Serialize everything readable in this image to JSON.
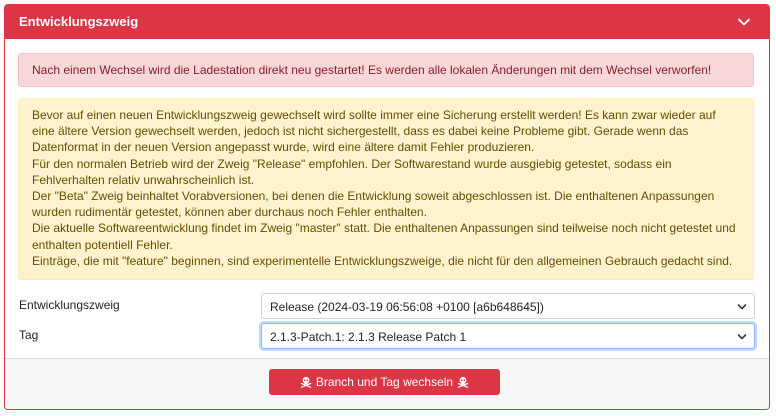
{
  "panel": {
    "title": "Entwicklungszweig"
  },
  "alerts": {
    "danger": "Nach einem Wechsel wird die Ladestation direkt neu gestartet! Es werden alle lokalen Änderungen mit dem Wechsel verworfen!",
    "warning": [
      "Bevor auf einen neuen Entwicklungszweig gewechselt wird sollte immer eine Sicherung erstellt werden! Es kann zwar wieder auf eine ältere Version gewechselt werden, jedoch ist nicht sichergestellt, dass es dabei keine Probleme gibt. Gerade wenn das Datenformat in der neuen Version angepasst wurde, wird eine ältere damit Fehler produzieren.",
      "Für den normalen Betrieb wird der Zweig \"Release\" empfohlen. Der Softwarestand wurde ausgiebig getestet, sodass ein Fehlverhalten relativ unwahrscheinlich ist.",
      "Der \"Beta\" Zweig beinhaltet Vorabversionen, bei denen die Entwicklung soweit abgeschlossen ist. Die enthaltenen Anpassungen wurden rudimentär getestet, können aber durchaus noch Fehler enthalten.",
      "Die aktuelle Softwareentwicklung findet im Zweig \"master\" statt. Die enthaltenen Anpassungen sind teilweise noch nicht getestet und enthalten potentiell Fehler.",
      "Einträge, die mit \"feature\" beginnen, sind experimentelle Entwicklungszweige, die nicht für den allgemeinen Gebrauch gedacht sind."
    ]
  },
  "form": {
    "branch_label": "Entwicklungszweig",
    "branch_value": "Release (2024-03-19 06:56:08 +0100 [a6b648645])",
    "tag_label": "Tag",
    "tag_value": "2.1.3-Patch.1: 2.1.3 Release Patch 1"
  },
  "footer": {
    "button_label": "Branch und Tag wechseln"
  },
  "colors": {
    "accent": "#dc3545",
    "danger_bg": "#f8d7da",
    "warning_bg": "#fff3cd"
  },
  "icons": {
    "header": "chevron-down-icon",
    "button": "skull-crossbones-icon"
  }
}
